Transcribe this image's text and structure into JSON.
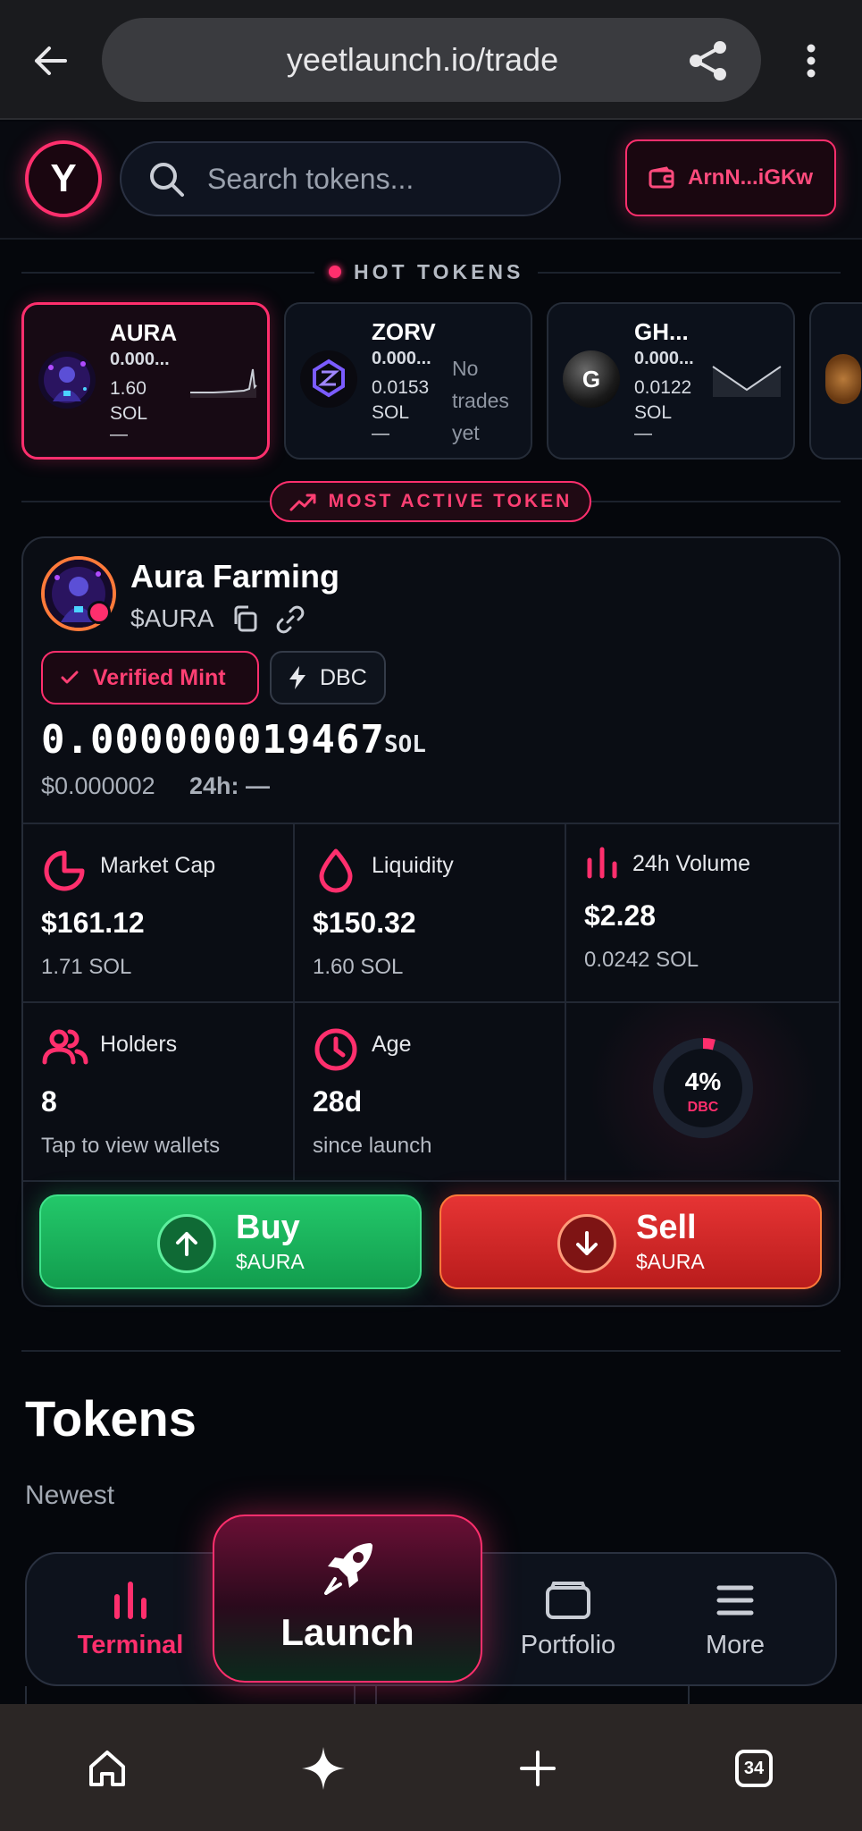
{
  "browser": {
    "url": "yeetlaunch.io/trade",
    "tab_count": "34"
  },
  "header": {
    "logo_letter": "Y",
    "search_placeholder": "Search tokens...",
    "wallet_label": "ArnN...iGKw"
  },
  "hot_tokens": {
    "title": "HOT TOKENS",
    "items": [
      {
        "name": "AURA",
        "price": "0.000...",
        "liquidity": "1.60 SOL",
        "change": "—",
        "note": ""
      },
      {
        "name": "ZORV",
        "price": "0.000...",
        "liquidity": "0.0153 SOL",
        "change": "—",
        "note": "No trades yet"
      },
      {
        "name": "GH...",
        "price": "0.000...",
        "liquidity": "0.0122 SOL",
        "change": "—",
        "note": "",
        "avatar_letter": "G"
      }
    ]
  },
  "most_active": {
    "label": "MOST ACTIVE TOKEN",
    "name": "Aura Farming",
    "ticker": "$AURA",
    "verified_label": "Verified Mint",
    "dbc_label": "DBC",
    "price": "0.000000019467",
    "price_unit": "SOL",
    "usd_price": "$0.000002",
    "change_24h": "24h: —",
    "stats": {
      "market_cap": {
        "label": "Market Cap",
        "value": "$161.12",
        "sub": "1.71 SOL"
      },
      "liquidity": {
        "label": "Liquidity",
        "value": "$150.32",
        "sub": "1.60 SOL"
      },
      "volume": {
        "label": "24h Volume",
        "value": "$2.28",
        "sub": "0.0242 SOL"
      },
      "holders": {
        "label": "Holders",
        "value": "8",
        "sub": "Tap to view wallets"
      },
      "age": {
        "label": "Age",
        "value": "28d",
        "sub": "since launch"
      },
      "dbc_progress": {
        "value": "4%",
        "label": "DBC",
        "fraction": 0.04
      }
    },
    "buy": {
      "label": "Buy",
      "sub": "$AURA"
    },
    "sell": {
      "label": "Sell",
      "sub": "$AURA"
    }
  },
  "tokens": {
    "title": "Tokens",
    "filter": "Newest"
  },
  "bottom_nav": {
    "terminal": "Terminal",
    "launch": "Launch",
    "portfolio": "Portfolio",
    "more": "More"
  },
  "colors": {
    "accent": "#ff2f6d",
    "buy": "#23c86a",
    "sell": "#e63434",
    "background": "#05070c"
  }
}
